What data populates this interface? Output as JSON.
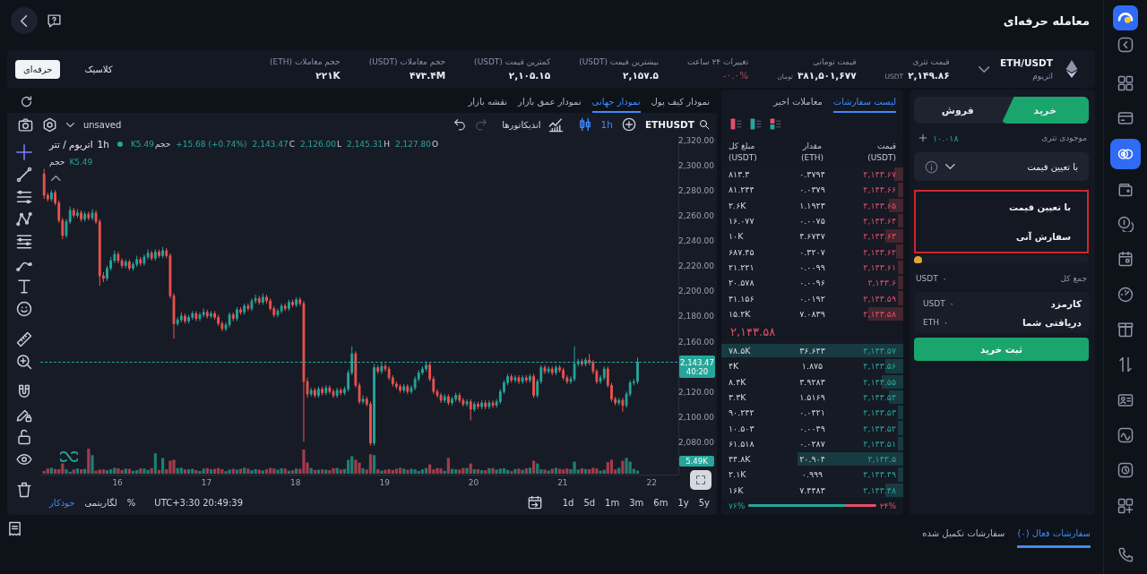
{
  "header": {
    "title": "معامله حرفه‌ای"
  },
  "sidebar": {
    "items": [
      {
        "selected": false
      },
      {
        "selected": false
      },
      {
        "selected": true
      },
      {
        "selected": false
      },
      {
        "selected": false
      },
      {
        "selected": false
      },
      {
        "selected": false
      },
      {
        "selected": false
      },
      {
        "selected": false
      },
      {
        "selected": false
      },
      {
        "selected": false
      },
      {
        "selected": false
      },
      {
        "selected": false
      }
    ]
  },
  "view_switch": [
    {
      "label": "کلاسیک",
      "selected": false
    },
    {
      "label": "حرفه‌ای",
      "selected": true
    }
  ],
  "ticker": {
    "symbol": "ETH/USDT",
    "name": "اتریوم",
    "stats": [
      {
        "label": "قیمت تتری",
        "value": "۲,۱۴۹.۸۶",
        "unit": "USDT"
      },
      {
        "label": "قیمت تومانی",
        "value": "۳۸۱,۵۰۱,۶۷۷",
        "unit": "تومان"
      },
      {
        "label": "تغییرات ۲۴ ساعت",
        "value": "-۰.۰%",
        "negative": true
      },
      {
        "label": "بیشترین قیمت (USDT)",
        "value": "۲,۱۵۷.۵"
      },
      {
        "label": "کمترین قیمت (USDT)",
        "value": "۲,۱۰۵.۱۵"
      },
      {
        "label": "حجم معاملات (USDT)",
        "value": "۴۷۳.۴M"
      },
      {
        "label": "حجم معاملات (ETH)",
        "value": "۲۲۱K"
      }
    ]
  },
  "chart_tabs": [
    {
      "label": "نمودار کیف پول",
      "selected": false
    },
    {
      "label": "نمودار جهانی",
      "selected": true
    },
    {
      "label": "نمودار عمق بازار",
      "selected": false
    },
    {
      "label": "نقشه بازار",
      "selected": false
    }
  ],
  "chart": {
    "toolbar": {
      "symbol": "ETHUSDT",
      "interval": "1h",
      "indicators": "اندیکاتورها",
      "layout": "unsaved",
      "history": [
        {
          "kind": "undo",
          "disabled": false
        },
        {
          "kind": "redo",
          "disabled": true
        }
      ]
    },
    "legend": {
      "title": "اتریوم / تتر",
      "interval": "1h",
      "values": [
        {
          "label": "O",
          "value": "2,127.80"
        },
        {
          "label": "H",
          "value": "2,145.31"
        },
        {
          "label": "L",
          "value": "2,126.00"
        },
        {
          "label": "C",
          "value": "2,143.47"
        }
      ],
      "change": "+15.68 (+0.74%)",
      "volume": {
        "label": "حجم",
        "value": "K5.49"
      }
    },
    "volume_legend": {
      "label": "حجم",
      "value": "K5.49"
    },
    "chart_data": {
      "type": "candlestick",
      "xlim": [
        15.133,
        22.3
      ],
      "ylim": [
        2054,
        2323
      ],
      "yticks": [
        {
          "value": 2320,
          "label": "2,320.00"
        },
        {
          "value": 2300,
          "label": "2,300.00"
        },
        {
          "value": 2280,
          "label": "2,280.00"
        },
        {
          "value": 2260,
          "label": "2,260.00"
        },
        {
          "value": 2240,
          "label": "2,240.00"
        },
        {
          "value": 2220,
          "label": "2,220.00"
        },
        {
          "value": 2200,
          "label": "2,200.00"
        },
        {
          "value": 2180,
          "label": "2,180.00"
        },
        {
          "value": 2160,
          "label": "2,160.00"
        },
        {
          "value": 2120,
          "label": "2,120.00"
        },
        {
          "value": 2100,
          "label": "2,100.00"
        },
        {
          "value": 2080,
          "label": "2,080.00"
        }
      ],
      "xticks": [
        {
          "value": 22,
          "label": "22"
        },
        {
          "value": 21,
          "label": "21"
        },
        {
          "value": 20,
          "label": "20"
        },
        {
          "value": 19,
          "label": "19"
        },
        {
          "value": 18,
          "label": "18"
        },
        {
          "value": 17,
          "label": "17"
        },
        {
          "value": 16,
          "label": "16"
        }
      ],
      "x": [
        15.175,
        15.217,
        15.258,
        15.3,
        15.342,
        15.383,
        15.425,
        15.467,
        15.508,
        15.55,
        15.592,
        15.633,
        15.675,
        15.717,
        15.758,
        15.8,
        15.842,
        15.883,
        15.925,
        15.967,
        16.008,
        16.05,
        16.092,
        16.133,
        16.175,
        16.217,
        16.258,
        16.3,
        16.342,
        16.383,
        16.425,
        16.467,
        16.508,
        16.55,
        16.592,
        16.633,
        16.675,
        16.717,
        16.758,
        16.8,
        16.842,
        16.883,
        16.925,
        16.967,
        17.008,
        17.05,
        17.092,
        17.133,
        17.175,
        17.217,
        17.258,
        17.3,
        17.342,
        17.383,
        17.425,
        17.467,
        17.508,
        17.55,
        17.592,
        17.633,
        17.675,
        17.717,
        17.758,
        17.8,
        17.842,
        17.883,
        17.925,
        17.967,
        18.008,
        18.05,
        18.092,
        18.133,
        18.175,
        18.217,
        18.258,
        18.3,
        18.342,
        18.383,
        18.425,
        18.467,
        18.508,
        18.55,
        18.592,
        18.633,
        18.675,
        18.717,
        18.758,
        18.8,
        18.842,
        18.883,
        18.925,
        18.967,
        19.008,
        19.05,
        19.092,
        19.133,
        19.175,
        19.217,
        19.258,
        19.3,
        19.342,
        19.383,
        19.425,
        19.467,
        19.508,
        19.55,
        19.592,
        19.633,
        19.675,
        19.717,
        19.758,
        19.8,
        19.842,
        19.883,
        19.925,
        19.967,
        20.008,
        20.05,
        20.092,
        20.133,
        20.175,
        20.217,
        20.258,
        20.3,
        20.342,
        20.383,
        20.425,
        20.467,
        20.508,
        20.55,
        20.592,
        20.633,
        20.675,
        20.717,
        20.758,
        20.8,
        20.842,
        20.883,
        20.925,
        20.967,
        21.008,
        21.05,
        21.092,
        21.133,
        21.175,
        21.217,
        21.258,
        21.3,
        21.342,
        21.383,
        21.425,
        21.467,
        21.508,
        21.55,
        21.592,
        21.633,
        21.675,
        21.717,
        21.758,
        21.8,
        21.842
      ],
      "ohlc": [
        [
          2293,
          2297,
          2273,
          2276
        ],
        [
          2276,
          2278,
          2271,
          2273
        ],
        [
          2273,
          2280,
          2271,
          2278
        ],
        [
          2278,
          2280,
          2268,
          2270
        ],
        [
          2270,
          2272,
          2254,
          2256
        ],
        [
          2256,
          2258,
          2241,
          2244
        ],
        [
          2244,
          2257,
          2242,
          2255
        ],
        [
          2255,
          2267,
          2253,
          2264
        ],
        [
          2264,
          2266,
          2258,
          2260
        ],
        [
          2260,
          2265,
          2258,
          2262
        ],
        [
          2262,
          2264,
          2255,
          2257
        ],
        [
          2257,
          2263,
          2255,
          2261
        ],
        [
          2261,
          2263,
          2256,
          2258
        ],
        [
          2258,
          2265,
          2256,
          2262
        ],
        [
          2262,
          2264,
          2253,
          2255
        ],
        [
          2255,
          2257,
          2204,
          2212
        ],
        [
          2212,
          2215,
          2207,
          2210
        ],
        [
          2210,
          2220,
          2208,
          2218
        ],
        [
          2218,
          2227,
          2216,
          2224
        ],
        [
          2224,
          2232,
          2222,
          2229
        ],
        [
          2229,
          2231,
          2222,
          2224
        ],
        [
          2224,
          2226,
          2218,
          2220
        ],
        [
          2220,
          2225,
          2218,
          2223
        ],
        [
          2223,
          2225,
          2216,
          2218
        ],
        [
          2218,
          2223,
          2216,
          2221
        ],
        [
          2221,
          2228,
          2219,
          2225
        ],
        [
          2225,
          2227,
          2220,
          2222
        ],
        [
          2222,
          2229,
          2220,
          2227
        ],
        [
          2227,
          2233,
          2225,
          2230
        ],
        [
          2230,
          2232,
          2224,
          2226
        ],
        [
          2226,
          2233,
          2224,
          2231
        ],
        [
          2231,
          2233,
          2226,
          2228
        ],
        [
          2228,
          2235,
          2226,
          2232
        ],
        [
          2232,
          2234,
          2226,
          2228
        ],
        [
          2228,
          2230,
          2194,
          2196
        ],
        [
          2196,
          2198,
          2162,
          2174
        ],
        [
          2174,
          2179,
          2172,
          2177
        ],
        [
          2177,
          2183,
          2175,
          2180
        ],
        [
          2180,
          2182,
          2174,
          2176
        ],
        [
          2176,
          2181,
          2174,
          2179
        ],
        [
          2179,
          2184,
          2177,
          2182
        ],
        [
          2182,
          2184,
          2176,
          2178
        ],
        [
          2178,
          2183,
          2176,
          2181
        ],
        [
          2181,
          2186,
          2179,
          2183
        ],
        [
          2183,
          2185,
          2178,
          2180
        ],
        [
          2180,
          2184,
          2178,
          2182
        ],
        [
          2182,
          2184,
          2177,
          2179
        ],
        [
          2179,
          2181,
          2172,
          2174
        ],
        [
          2174,
          2176,
          2168,
          2170
        ],
        [
          2170,
          2175,
          2168,
          2173
        ],
        [
          2173,
          2183,
          2171,
          2181
        ],
        [
          2181,
          2183,
          2176,
          2178
        ],
        [
          2178,
          2187,
          2176,
          2185
        ],
        [
          2185,
          2187,
          2181,
          2183
        ],
        [
          2183,
          2190,
          2181,
          2188
        ],
        [
          2188,
          2190,
          2184,
          2186
        ],
        [
          2186,
          2194,
          2184,
          2192
        ],
        [
          2192,
          2197,
          2190,
          2194
        ],
        [
          2194,
          2196,
          2189,
          2191
        ],
        [
          2191,
          2198,
          2189,
          2195
        ],
        [
          2195,
          2197,
          2190,
          2192
        ],
        [
          2192,
          2194,
          2184,
          2186
        ],
        [
          2186,
          2188,
          2179,
          2181
        ],
        [
          2181,
          2186,
          2179,
          2184
        ],
        [
          2184,
          2190,
          2182,
          2188
        ],
        [
          2188,
          2190,
          2184,
          2186
        ],
        [
          2186,
          2193,
          2184,
          2191
        ],
        [
          2191,
          2193,
          2187,
          2189
        ],
        [
          2189,
          2195,
          2187,
          2193
        ],
        [
          2193,
          2195,
          2188,
          2190
        ],
        [
          2190,
          2192,
          2080,
          2128
        ],
        [
          2128,
          2131,
          2115,
          2118
        ],
        [
          2118,
          2123,
          2116,
          2121
        ],
        [
          2121,
          2123,
          2115,
          2117
        ],
        [
          2117,
          2124,
          2115,
          2122
        ],
        [
          2122,
          2124,
          2117,
          2119
        ],
        [
          2119,
          2125,
          2117,
          2123
        ],
        [
          2123,
          2125,
          2118,
          2120
        ],
        [
          2120,
          2122,
          2115,
          2117
        ],
        [
          2117,
          2123,
          2115,
          2121
        ],
        [
          2121,
          2123,
          2117,
          2119
        ],
        [
          2119,
          2124,
          2117,
          2122
        ],
        [
          2122,
          2137,
          2120,
          2135
        ],
        [
          2135,
          2156,
          2133,
          2150
        ],
        [
          2150,
          2152,
          2123,
          2125
        ],
        [
          2125,
          2127,
          2110,
          2112
        ],
        [
          2112,
          2117,
          2110,
          2114
        ],
        [
          2114,
          2116,
          2108,
          2110
        ],
        [
          2110,
          2112,
          2077,
          2079
        ],
        [
          2079,
          2142,
          2077,
          2139
        ],
        [
          2139,
          2141,
          2134,
          2136
        ],
        [
          2136,
          2143,
          2134,
          2140
        ],
        [
          2140,
          2142,
          2136,
          2138
        ],
        [
          2138,
          2140,
          2129,
          2131
        ],
        [
          2131,
          2133,
          2124,
          2126
        ],
        [
          2126,
          2128,
          2122,
          2124
        ],
        [
          2124,
          2126,
          2119,
          2121
        ],
        [
          2121,
          2126,
          2119,
          2124
        ],
        [
          2124,
          2126,
          2118,
          2120
        ],
        [
          2120,
          2125,
          2118,
          2123
        ],
        [
          2123,
          2132,
          2121,
          2130
        ],
        [
          2130,
          2137,
          2128,
          2135
        ],
        [
          2135,
          2140,
          2133,
          2138
        ],
        [
          2138,
          2144,
          2136,
          2141
        ],
        [
          2141,
          2143,
          2128,
          2130
        ],
        [
          2130,
          2132,
          2118,
          2120
        ],
        [
          2120,
          2122,
          2115,
          2117
        ],
        [
          2117,
          2119,
          2111,
          2113
        ],
        [
          2113,
          2118,
          2111,
          2116
        ],
        [
          2116,
          2118,
          2109,
          2111
        ],
        [
          2111,
          2116,
          2109,
          2114
        ],
        [
          2114,
          2119,
          2112,
          2117
        ],
        [
          2117,
          2119,
          2111,
          2113
        ],
        [
          2113,
          2115,
          2108,
          2110
        ],
        [
          2110,
          2114,
          2108,
          2112
        ],
        [
          2112,
          2114,
          2097,
          2106
        ],
        [
          2106,
          2112,
          2104,
          2110
        ],
        [
          2110,
          2112,
          2106,
          2108
        ],
        [
          2108,
          2113,
          2106,
          2111
        ],
        [
          2111,
          2113,
          2106,
          2108
        ],
        [
          2108,
          2113,
          2106,
          2111
        ],
        [
          2111,
          2113,
          2107,
          2109
        ],
        [
          2109,
          2114,
          2107,
          2112
        ],
        [
          2112,
          2122,
          2110,
          2120
        ],
        [
          2120,
          2129,
          2118,
          2127
        ],
        [
          2127,
          2134,
          2125,
          2132
        ],
        [
          2132,
          2134,
          2127,
          2129
        ],
        [
          2129,
          2133,
          2127,
          2131
        ],
        [
          2131,
          2133,
          2126,
          2128
        ],
        [
          2128,
          2133,
          2126,
          2131
        ],
        [
          2131,
          2133,
          2127,
          2129
        ],
        [
          2129,
          2134,
          2127,
          2132
        ],
        [
          2132,
          2134,
          2115,
          2117
        ],
        [
          2117,
          2130,
          2115,
          2128
        ],
        [
          2128,
          2141,
          2126,
          2139
        ],
        [
          2139,
          2141,
          2134,
          2136
        ],
        [
          2136,
          2140,
          2134,
          2138
        ],
        [
          2138,
          2140,
          2133,
          2135
        ],
        [
          2135,
          2141,
          2133,
          2139
        ],
        [
          2139,
          2141,
          2135,
          2137
        ],
        [
          2137,
          2139,
          2129,
          2131
        ],
        [
          2131,
          2133,
          2126,
          2128
        ],
        [
          2128,
          2132,
          2126,
          2130
        ],
        [
          2130,
          2156,
          2128,
          2142
        ],
        [
          2142,
          2146,
          2140,
          2144
        ],
        [
          2144,
          2146,
          2140,
          2142
        ],
        [
          2142,
          2147,
          2140,
          2145
        ],
        [
          2145,
          2150,
          2141,
          2143
        ],
        [
          2143,
          2145,
          2134,
          2136
        ],
        [
          2136,
          2138,
          2126,
          2128
        ],
        [
          2128,
          2133,
          2126,
          2131
        ],
        [
          2131,
          2140,
          2129,
          2138
        ],
        [
          2138,
          2140,
          2123,
          2125
        ],
        [
          2125,
          2127,
          2112,
          2114
        ],
        [
          2114,
          2116,
          2109,
          2111
        ],
        [
          2111,
          2115,
          2109,
          2113
        ],
        [
          2113,
          2115,
          2104,
          2109
        ],
        [
          2109,
          2120,
          2107,
          2118
        ],
        [
          2118,
          2129,
          2116,
          2127
        ],
        [
          2127,
          2130,
          2125,
          2128
        ],
        [
          2128,
          2147,
          2126,
          2143.47
        ]
      ]
    },
    "last_price": {
      "value": "2,143.47",
      "countdown": "40:20"
    },
    "volume_tag": "5.49K",
    "scale_modes": [
      {
        "label": "%",
        "selected": false
      },
      {
        "label": "لگاریتمی",
        "selected": false
      },
      {
        "label": "خودکار",
        "selected": true
      }
    ],
    "clock": "UTC+3:30 20:49:39",
    "ranges": [
      "5y",
      "1y",
      "6m",
      "3m",
      "1m",
      "5d",
      "1d"
    ]
  },
  "order_book": {
    "tabs": [
      {
        "label": "لیست سفارشات",
        "selected": true
      },
      {
        "label": "معاملات اخیر",
        "selected": false
      }
    ],
    "columns": [
      {
        "label": "قیمت",
        "unit": "(USDT)"
      },
      {
        "label": "مقدار",
        "unit": "(ETH)"
      },
      {
        "label": "مبلغ کل",
        "unit": "(USDT)"
      }
    ],
    "asks": [
      {
        "price": "۲,۱۴۳.۶۷",
        "amount": "۰.۳۷۹۴",
        "total": "۸۱۳.۳",
        "level": 0.05
      },
      {
        "price": "۲,۱۴۳.۶۶",
        "amount": "۰.۰۳۷۹",
        "total": "۸۱.۲۴۴",
        "level": 0.03
      },
      {
        "price": "۲,۱۴۳.۶۵",
        "amount": "۱.۱۹۲۳",
        "total": "۲.۶K",
        "level": 0.08
      },
      {
        "price": "۲,۱۴۳.۶۴",
        "amount": "۰.۰۰۷۵",
        "total": "۱۶.۰۷۷",
        "level": 0.03
      },
      {
        "price": "۲,۱۴۳.۶۳",
        "amount": "۴.۶۷۴۷",
        "total": "۱۰K",
        "level": 0.1
      },
      {
        "price": "۲,۱۴۳.۶۲",
        "amount": "۰.۳۲۰۷",
        "total": "۶۸۷.۴۵",
        "level": 0.04
      },
      {
        "price": "۲,۱۴۳.۶۱",
        "amount": "۰.۰۰۹۹",
        "total": "۲۱.۲۲۱",
        "level": 0.03
      },
      {
        "price": "۲,۱۴۳.۶",
        "amount": "۰.۰۰۹۶",
        "total": "۲۰.۵۷۸",
        "level": 0.03
      },
      {
        "price": "۲,۱۴۳.۵۹",
        "amount": "۰.۰۱۹۲",
        "total": "۴۱.۱۵۶",
        "level": 0.03
      },
      {
        "price": "۲,۱۴۳.۵۸",
        "amount": "۷.۰۸۳۹",
        "total": "۱۵.۲K",
        "level": 0.19
      }
    ],
    "last_price": "۲,۱۴۳.۵۸",
    "bids": [
      {
        "price": "۲,۱۴۳.۵۷",
        "amount": "۳۶.۶۴۳",
        "total": "۷۸.۵K",
        "level": 1
      },
      {
        "price": "۲,۱۴۳.۵۶",
        "amount": "۱.۸۷۵",
        "total": "۴K",
        "level": 0.1
      },
      {
        "price": "۲,۱۴۳.۵۵",
        "amount": "۳.۹۲۸۳",
        "total": "۸.۴K",
        "level": 0.12
      },
      {
        "price": "۲,۱۴۳.۵۴",
        "amount": "۱.۵۱۶۹",
        "total": "۳.۳K",
        "level": 0.08
      },
      {
        "price": "۲,۱۴۳.۵۳",
        "amount": "۰.۰۴۲۱",
        "total": "۹۰.۲۴۲",
        "level": 0.03
      },
      {
        "price": "۲,۱۴۳.۵۲",
        "amount": "۰.۰۰۴۹",
        "total": "۱۰.۵۰۳",
        "level": 0.03
      },
      {
        "price": "۲,۱۴۳.۵۱",
        "amount": "۰.۰۲۸۷",
        "total": "۶۱.۵۱۸",
        "level": 0.03
      },
      {
        "price": "۲,۱۴۳.۵",
        "amount": "۲۰.۹۰۴",
        "total": "۴۴.۸K",
        "level": 0.58
      },
      {
        "price": "۲,۱۴۳.۴۹",
        "amount": "۰.۹۹۹",
        "total": "۲.۱K",
        "level": 0.03
      },
      {
        "price": "۲,۱۴۳.۴۸",
        "amount": "۷.۴۴۸۳",
        "total": "۱۶K",
        "level": 0.1
      }
    ],
    "ratio": {
      "buy": "۷۶%",
      "sell": "۲۴%",
      "level": 0.76
    }
  },
  "order_form": {
    "sides": [
      {
        "label": "خرید",
        "kind": "buy",
        "selected": true
      },
      {
        "label": "فروش",
        "kind": "sell",
        "selected": false
      }
    ],
    "balance": {
      "label": "موجودی تتری",
      "value": "۱۰.۰۱۸"
    },
    "order_type": {
      "value": "با تعیین قیمت",
      "expanded": true,
      "highlighted": true,
      "options": [
        {
          "label": "با تعیین قیمت"
        },
        {
          "label": "سفارش آنی"
        }
      ]
    },
    "slider": {
      "level": 0
    },
    "total": {
      "label": "جمع کل",
      "value": "۰",
      "unit": "USDT"
    },
    "summary": [
      {
        "label": "کارمزد",
        "value": "۰",
        "unit": "USDT"
      },
      {
        "label": "دریافتی شما",
        "value": "۰",
        "unit": "ETH"
      }
    ],
    "submit": "ثبت خرید"
  },
  "orders_tabs": [
    {
      "label": "سفارشات فعال (۰)",
      "selected": true
    },
    {
      "label": "سفارشات تکمیل شده",
      "selected": false
    }
  ]
}
